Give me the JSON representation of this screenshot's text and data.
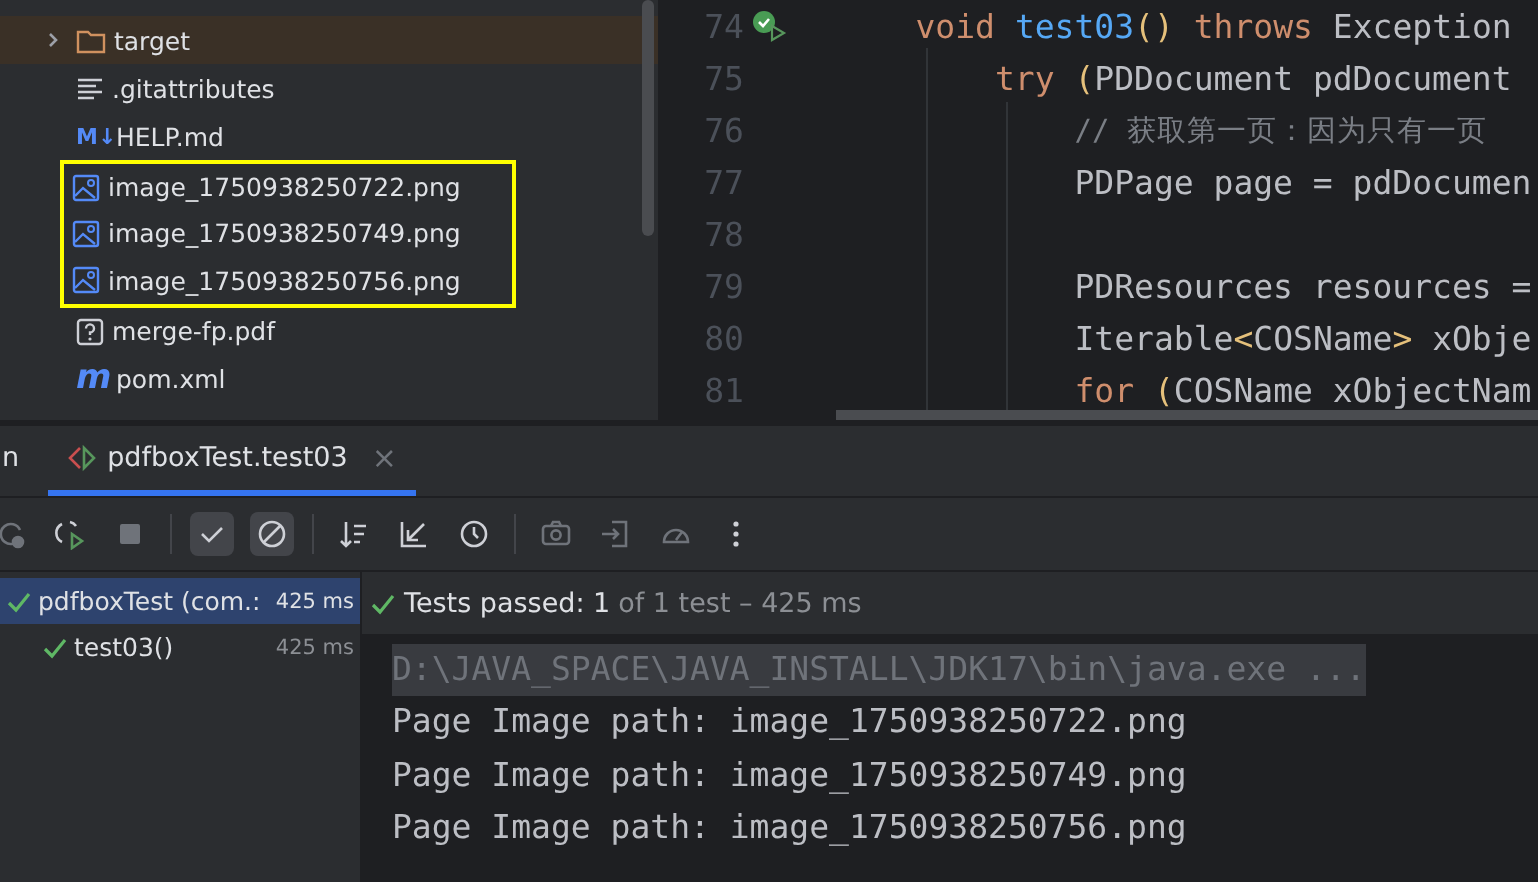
{
  "project_tree": {
    "items": [
      {
        "name": "target",
        "kind": "folder",
        "expanded": false,
        "excluded": true,
        "highlighted": false
      },
      {
        "name": ".gitattributes",
        "kind": "text",
        "highlighted": false
      },
      {
        "name": "HELP.md",
        "kind": "markdown",
        "icon_text": "M↓",
        "highlighted": false
      },
      {
        "name": "image_1750938250722.png",
        "kind": "image",
        "highlighted": true
      },
      {
        "name": "image_1750938250749.png",
        "kind": "image",
        "highlighted": true
      },
      {
        "name": "image_1750938250756.png",
        "kind": "image",
        "highlighted": true
      },
      {
        "name": "merge-fp.pdf",
        "kind": "unknown",
        "highlighted": false
      },
      {
        "name": "pom.xml",
        "kind": "maven",
        "icon_text": "m",
        "highlighted": false
      }
    ]
  },
  "editor": {
    "lines": [
      {
        "number": "74",
        "run_marker": true,
        "tokens": [
          {
            "kind": "keyword",
            "text": "    void"
          },
          {
            "kind": "method",
            "text": " test03"
          },
          {
            "kind": "bracket",
            "text": "()"
          },
          {
            "kind": "keyword",
            "text": " throws"
          },
          {
            "kind": "plain",
            "text": " Exception"
          }
        ]
      },
      {
        "number": "75",
        "run_marker": false,
        "tokens": [
          {
            "kind": "keyword",
            "text": "        try"
          },
          {
            "kind": "bracket",
            "text": " ("
          },
          {
            "kind": "plain",
            "text": "PDDocument pdDocument"
          }
        ]
      },
      {
        "number": "76",
        "run_marker": false,
        "tokens": [
          {
            "kind": "comment",
            "text": "            // 获取第一页：因为只有一页"
          }
        ]
      },
      {
        "number": "77",
        "run_marker": false,
        "tokens": [
          {
            "kind": "plain",
            "text": "            PDPage page = pdDocumen"
          }
        ]
      },
      {
        "number": "78",
        "run_marker": false
      },
      {
        "number": "79",
        "run_marker": false,
        "tokens": [
          {
            "kind": "plain",
            "text": "            PDResources resources ="
          }
        ]
      },
      {
        "number": "80",
        "run_marker": false,
        "tokens": [
          {
            "kind": "plain",
            "text": "            Iterable"
          },
          {
            "kind": "bracket",
            "text": "<"
          },
          {
            "kind": "plain",
            "text": "COSName"
          },
          {
            "kind": "bracket",
            "text": ">"
          },
          {
            "kind": "plain",
            "text": " xObje"
          }
        ]
      },
      {
        "number": "81",
        "run_marker": false,
        "tokens": [
          {
            "kind": "keyword",
            "text": "            for"
          },
          {
            "kind": "bracket",
            "text": " ("
          },
          {
            "kind": "plain",
            "text": "COSName xObjectNam"
          }
        ]
      }
    ]
  },
  "run_tabs": [
    {
      "label": "n",
      "kind": "plain",
      "selected": false
    },
    {
      "label": "pdfboxTest.test03",
      "kind": "test",
      "selected": true,
      "close": "×"
    }
  ],
  "toolbar": [
    {
      "kind": "rerun",
      "disabled": true,
      "toggled": false
    },
    {
      "kind": "rerun-failed",
      "disabled": false,
      "toggled": false
    },
    {
      "kind": "stop",
      "disabled": true,
      "toggled": false
    },
    {
      "kind": "separator"
    },
    {
      "kind": "show-passed",
      "disabled": false,
      "toggled": true
    },
    {
      "kind": "show-ignored",
      "disabled": false,
      "toggled": true
    },
    {
      "kind": "separator"
    },
    {
      "kind": "sort",
      "disabled": false,
      "toggled": false
    },
    {
      "kind": "collapse",
      "disabled": false,
      "toggled": false
    },
    {
      "kind": "history",
      "disabled": false,
      "toggled": false
    },
    {
      "kind": "separator"
    },
    {
      "kind": "camera",
      "disabled": true,
      "toggled": false
    },
    {
      "kind": "import",
      "disabled": true,
      "toggled": false
    },
    {
      "kind": "gauge",
      "disabled": true,
      "toggled": false
    },
    {
      "kind": "more",
      "disabled": false,
      "toggled": false
    }
  ],
  "test_tree": [
    {
      "label": "pdfboxTest (com.:",
      "time": "425 ms",
      "passed": true,
      "selected": true,
      "children": [
        {
          "label": "test03()",
          "time": "425 ms",
          "passed": true,
          "selected": false
        }
      ]
    }
  ],
  "status": {
    "passed": true,
    "summary": "Tests passed: 1",
    "detail": "of 1 test – 425 ms"
  },
  "console": [
    {
      "kind": "command",
      "text": "D:\\JAVA_SPACE\\JAVA_INSTALL\\JDK17\\bin\\java.exe ..."
    },
    {
      "kind": "output",
      "text": "Page Image path: image_1750938250722.png"
    },
    {
      "kind": "output",
      "text": "Page Image path: image_1750938250749.png"
    },
    {
      "kind": "output",
      "text": "Page Image path: image_1750938250756.png"
    }
  ]
}
